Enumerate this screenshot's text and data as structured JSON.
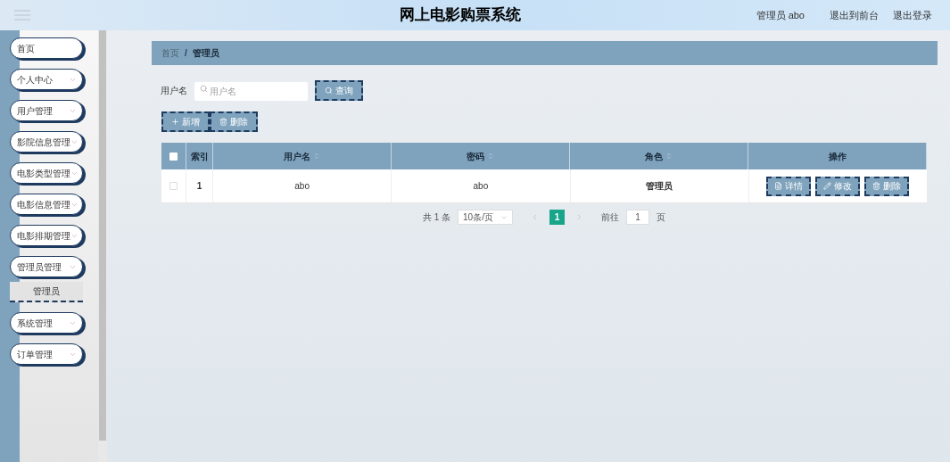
{
  "header": {
    "title": "网上电影购票系统",
    "user": "管理员 abo",
    "links": [
      "退出到前台",
      "退出登录"
    ]
  },
  "sidebar": {
    "items": [
      {
        "label": "首页",
        "kind": "link"
      },
      {
        "label": "个人中心",
        "kind": "menu"
      },
      {
        "label": "用户管理",
        "kind": "menu"
      },
      {
        "label": "影院信息管理",
        "kind": "menu"
      },
      {
        "label": "电影类型管理",
        "kind": "menu"
      },
      {
        "label": "电影信息管理",
        "kind": "menu"
      },
      {
        "label": "电影排期管理",
        "kind": "menu"
      },
      {
        "label": "管理员管理",
        "kind": "menu",
        "children": [
          {
            "label": "管理员",
            "selected": true
          }
        ]
      },
      {
        "label": "系统管理",
        "kind": "menu"
      },
      {
        "label": "订单管理",
        "kind": "menu"
      }
    ]
  },
  "breadcrumb": {
    "items": [
      "首页",
      "管理员"
    ],
    "separator": "/"
  },
  "search": {
    "label": "用户名",
    "placeholder": "用户名",
    "button": "查询"
  },
  "actions": [
    "新增",
    "删除"
  ],
  "table": {
    "all_checked": false,
    "columns": [
      {
        "label": "索引",
        "sortable": false
      },
      {
        "label": "用户名",
        "sortable": true
      },
      {
        "label": "密码",
        "sortable": true
      },
      {
        "label": "角色",
        "sortable": true
      },
      {
        "label": "操作",
        "sortable": false
      }
    ],
    "rows": [
      {
        "checked": false,
        "cells": [
          "1",
          "abo",
          "abo",
          "管理员"
        ],
        "buttons": [
          {
            "kind": "detail",
            "label": "详情"
          },
          {
            "kind": "edit",
            "label": "修改"
          },
          {
            "kind": "delete",
            "label": "删除"
          }
        ]
      }
    ]
  },
  "pagination": {
    "total": "共 1 条",
    "page_size": "10条/页",
    "pages": [
      {
        "label": "1",
        "selected": true
      }
    ],
    "goto_label": "前往",
    "goto_value": "1",
    "goto_suffix": "页"
  }
}
